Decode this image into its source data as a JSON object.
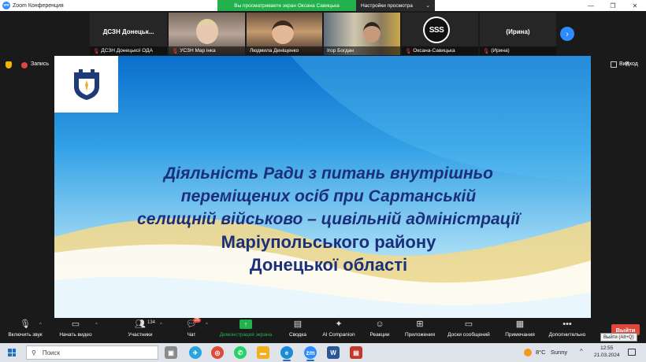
{
  "window": {
    "app_icon_text": "zm",
    "title": "Zoom Конференция",
    "controls": [
      "—",
      "❐",
      "✕"
    ]
  },
  "share_banner": "Вы просматриваете экран Оксана Савицька",
  "view_options": {
    "label": "Настройки просмотра",
    "caret": "⌄"
  },
  "participants": [
    {
      "name": "ДСЗН Донецької ОДА",
      "big_name": "ДСЗН  Донецьк...",
      "muted": true
    },
    {
      "name": "УСЗН Мар інка",
      "muted": true
    },
    {
      "name": "Людмила Деніщенко",
      "muted": false
    },
    {
      "name": "Ігор Богдан",
      "muted": false
    },
    {
      "name": "Оксана-Савицька",
      "logo_text": "SSS",
      "muted": true
    },
    {
      "name": "(Ирина)",
      "big_name": "(Ирина)",
      "muted": true
    }
  ],
  "meeting": {
    "record_label": "Запись",
    "view_label": "Вид",
    "exit_fullscreen": "Вход"
  },
  "slide": {
    "lines": [
      "Діяльність Ради з питань внутрішньо",
      "переміщених осіб при Сартанській",
      "селищній військово – цивільній адміністрації",
      "Маріупольського району",
      "Донецької області"
    ]
  },
  "toolbar": {
    "unmute": "Включить звук",
    "start_video": "Начать видео",
    "participants": "Участники",
    "participants_count": "134",
    "chat": "Чат",
    "chat_badge": "25",
    "share_screen": "Демонстрация экрана",
    "summary": "Сводка",
    "ai_companion": "AI Companion",
    "reactions": "Реакции",
    "apps": "Приложения",
    "whiteboards": "Доски сообщений",
    "notes": "Примечания",
    "more": "Дополнительно",
    "leave": "Выйти",
    "leave_tooltip": "Выйти (Alt+Q)"
  },
  "taskbar": {
    "search_placeholder": "Поиск",
    "weather_temp": "8°C",
    "weather_desc": "Sunny",
    "time": "12:55",
    "date": "21.03.2024",
    "zoom_app_text": "zm",
    "word_app_text": "W"
  },
  "colors": {
    "accent": "#2d8cff",
    "share_green": "#23b14d",
    "leave_red": "#e0463a",
    "slide_text": "#1b2f7a"
  }
}
